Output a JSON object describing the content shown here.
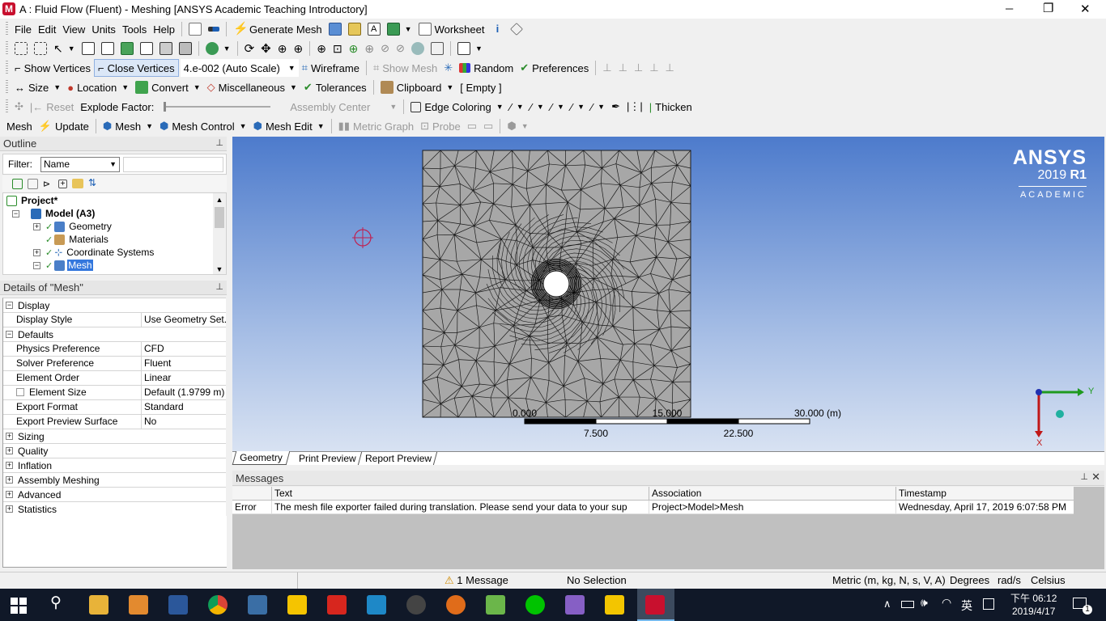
{
  "window": {
    "title": "A : Fluid Flow (Fluent) - Meshing [ANSYS Academic Teaching Introductory]",
    "minimize": "─",
    "restore": "❐",
    "close": "✕"
  },
  "menu": [
    "File",
    "Edit",
    "View",
    "Units",
    "Tools",
    "Help"
  ],
  "toolbar1": {
    "generate_mesh": "Generate Mesh",
    "worksheet": "Worksheet"
  },
  "toolbar3": {
    "show_vertices": "Show Vertices",
    "close_vertices": "Close Vertices",
    "scale_value": "4.e-002 (Auto Scale)",
    "wireframe": "Wireframe",
    "show_mesh": "Show Mesh",
    "random": "Random",
    "preferences": "Preferences"
  },
  "toolbar4": {
    "size": "Size",
    "location": "Location",
    "convert": "Convert",
    "miscellaneous": "Miscellaneous",
    "tolerances": "Tolerances",
    "clipboard": "Clipboard",
    "empty": "[ Empty ]"
  },
  "toolbar5": {
    "reset": "Reset",
    "explode_factor": "Explode Factor:",
    "assembly_center": "Assembly Center",
    "edge_coloring": "Edge Coloring",
    "thicken": "Thicken"
  },
  "toolbar6": {
    "mesh_label": "Mesh",
    "update": "Update",
    "mesh": "Mesh",
    "mesh_control": "Mesh Control",
    "mesh_edit": "Mesh Edit",
    "metric_graph": "Metric Graph",
    "probe": "Probe"
  },
  "outline": {
    "title": "Outline",
    "pin": "ᵖ",
    "filter_label": "Filter:",
    "filter_value": "Name",
    "tree": [
      {
        "label": "Project*",
        "level": 0,
        "bold": true
      },
      {
        "label": "Model (A3)",
        "level": 1,
        "bold": true
      },
      {
        "label": "Geometry",
        "level": 2
      },
      {
        "label": "Materials",
        "level": 2
      },
      {
        "label": "Coordinate Systems",
        "level": 2
      },
      {
        "label": "Mesh",
        "level": 2,
        "selected": true
      }
    ]
  },
  "details": {
    "title": "Details of \"Mesh\"",
    "display_group": "Display",
    "display_style_k": "Display Style",
    "display_style_v": "Use Geometry Set...",
    "defaults_group": "Defaults",
    "physics_k": "Physics Preference",
    "physics_v": "CFD",
    "solver_k": "Solver Preference",
    "solver_v": "Fluent",
    "order_k": "Element Order",
    "order_v": "Linear",
    "size_k": "Element Size",
    "size_v": "Default (1.9799 m)",
    "format_k": "Export Format",
    "format_v": "Standard",
    "preview_k": "Export Preview Surface Mesh",
    "preview_v": "No",
    "groups": [
      "Sizing",
      "Quality",
      "Inflation",
      "Assembly Meshing",
      "Advanced",
      "Statistics"
    ]
  },
  "viewport": {
    "logo_ansys": "ANSYS",
    "logo_version": "2019",
    "logo_release": "R1",
    "logo_academic": "ACADEMIC",
    "scale_labels_top": [
      "0.000",
      "15.000",
      "30.000 (m)"
    ],
    "scale_labels_bottom": [
      "7.500",
      "22.500"
    ],
    "triad_y": "Y",
    "triad_x": "X"
  },
  "tabs": [
    "Geometry",
    "Print Preview",
    "Report Preview"
  ],
  "messages": {
    "title": "Messages",
    "columns": [
      "Text",
      "Association",
      "Timestamp"
    ],
    "rows": [
      {
        "type": "Error",
        "text": "The mesh file exporter failed during translation.  Please send your data to your sup",
        "association": "Project>Model>Mesh",
        "timestamp": "Wednesday, April 17, 2019 6:07:58 PM"
      }
    ]
  },
  "status": {
    "messages": "1 Message",
    "selection": "No Selection",
    "units": "Metric (m, kg, N, s, V, A)",
    "degrees": "Degrees",
    "rads": "rad/s",
    "celsius": "Celsius"
  },
  "taskbar": {
    "time": "下午 06:12",
    "date": "2019/4/17",
    "ime": "英",
    "notif": "1"
  },
  "colors": {
    "accent": "#0078d7",
    "viewport_top": "#4d7bcc",
    "mesh_fill": "#a7a7a7",
    "error_icon": "#c0392b"
  }
}
